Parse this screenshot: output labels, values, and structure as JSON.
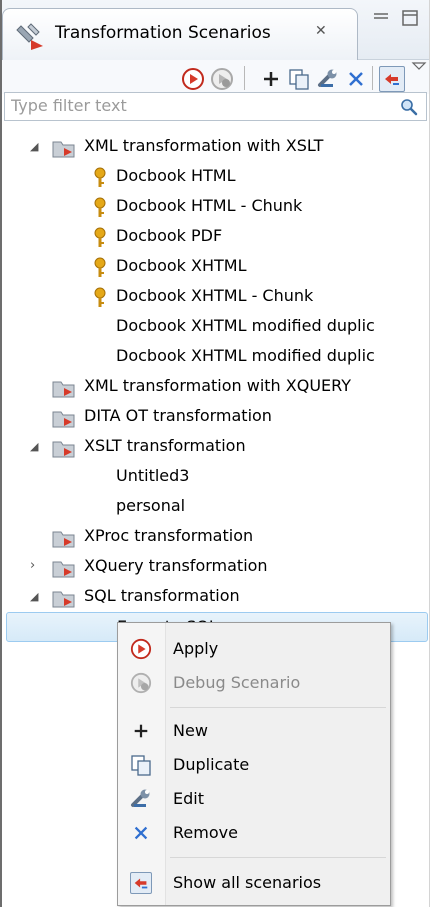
{
  "view": {
    "title": "Transformation Scenarios",
    "close_glyph": "✕",
    "minimize_glyph": "▭",
    "maximize_glyph": "▢"
  },
  "toolbar": {
    "icons": [
      "apply-icon",
      "debug-icon",
      "new-icon",
      "duplicate-icon",
      "edit-icon",
      "remove-icon",
      "show-all-icon",
      "view-menu-icon"
    ]
  },
  "filter": {
    "placeholder": "Type filter text",
    "value": ""
  },
  "tree": {
    "groups": [
      {
        "label": "XML transformation with XSLT",
        "expanded": true,
        "items": [
          {
            "label": "Docbook HTML",
            "icon": "key-icon"
          },
          {
            "label": "Docbook HTML - Chunk",
            "icon": "key-icon"
          },
          {
            "label": "Docbook PDF",
            "icon": "key-icon"
          },
          {
            "label": "Docbook XHTML",
            "icon": "key-icon"
          },
          {
            "label": "Docbook XHTML - Chunk",
            "icon": "key-icon"
          },
          {
            "label": "Docbook XHTML modified duplic",
            "icon": ""
          },
          {
            "label": "Docbook XHTML modified duplic",
            "icon": ""
          }
        ]
      },
      {
        "label": "XML transformation with XQUERY",
        "expanded": false
      },
      {
        "label": "DITA OT transformation",
        "expanded": false
      },
      {
        "label": "XSLT transformation",
        "expanded": true,
        "items": [
          {
            "label": "Untitled3",
            "icon": ""
          },
          {
            "label": "personal",
            "icon": ""
          }
        ]
      },
      {
        "label": "XProc transformation",
        "expanded": false
      },
      {
        "label": "XQuery transformation",
        "expanded": false,
        "has_children": true
      },
      {
        "label": "SQL transformation",
        "expanded": true,
        "items": [
          {
            "label": "Execute SQL",
            "icon": "",
            "selected": true
          }
        ]
      }
    ]
  },
  "context_menu": {
    "items": [
      {
        "label": "Apply",
        "icon": "apply-icon",
        "enabled": true
      },
      {
        "label": "Debug Scenario",
        "icon": "debug-icon",
        "enabled": false
      },
      {
        "label": "New",
        "icon": "plus-icon",
        "enabled": true
      },
      {
        "label": "Duplicate",
        "icon": "duplicate-icon",
        "enabled": true
      },
      {
        "label": "Edit",
        "icon": "wrench-icon",
        "enabled": true
      },
      {
        "label": "Remove",
        "icon": "remove-icon",
        "enabled": true
      },
      {
        "label": "Show all scenarios",
        "icon": "show-all-icon",
        "enabled": true
      }
    ]
  },
  "colors": {
    "accent_red": "#d63a2a",
    "selection_bg": "#d6eaf8",
    "selection_border": "#9ccbf0",
    "key_gold": "#d79a18"
  }
}
